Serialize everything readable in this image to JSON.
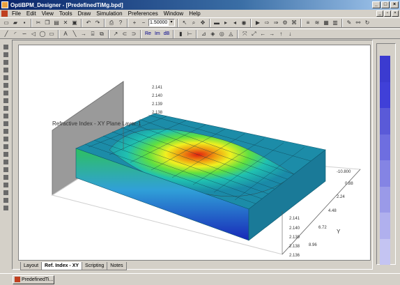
{
  "window": {
    "title": "OptiBPM_Designer - [PredefinedTiMg.bpd]"
  },
  "menu": {
    "items": [
      "File",
      "Edit",
      "View",
      "Tools",
      "Draw",
      "Simulation",
      "Preferences",
      "Window",
      "Help"
    ]
  },
  "toolbar": {
    "zoom_value": "1.50000",
    "re_label": "Re",
    "im_label": "Im",
    "db_label": "dB"
  },
  "plot": {
    "title": "Refractive Index - XY Plane Layer-1",
    "z_ticks": [
      "2.141",
      "2.140",
      "2.139",
      "2.138"
    ],
    "z_ticks_front": [
      "2.141",
      "2.140",
      "2.139",
      "2.138",
      "2.136"
    ],
    "y_ticks": [
      "-10.800",
      "0.88",
      "2.24",
      "4.48",
      "6.72",
      "8.96"
    ],
    "y_label": "Y"
  },
  "tabs": [
    "Layout",
    "Ref. Index - XY",
    "Scripting",
    "Notes"
  ],
  "active_tab": "Ref. Index - XY",
  "taskbar": {
    "doc_label": "PredefinedTi..."
  },
  "legend_colors": [
    "#3b3bd0",
    "#4040d8",
    "#5a5ad8",
    "#6e6ee0",
    "#8484e4",
    "#9a9ae8",
    "#b0b0ee",
    "#c4c4f2"
  ]
}
